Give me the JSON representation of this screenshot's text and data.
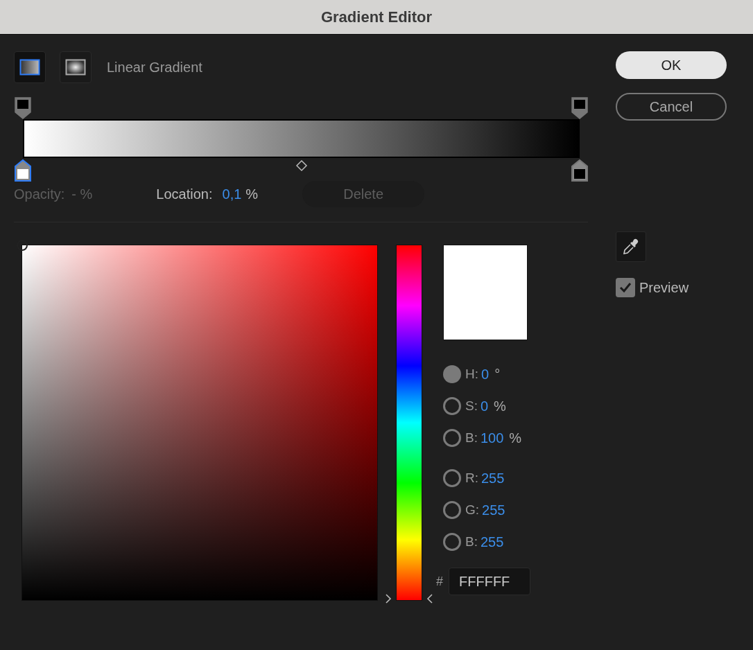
{
  "window": {
    "title": "Gradient Editor"
  },
  "gradient_types": [
    {
      "kind": "linear",
      "selected": true
    },
    {
      "kind": "radial",
      "selected": false
    }
  ],
  "gradient_type_label": "Linear Gradient",
  "opacity_stops": [
    {
      "color": "#000000",
      "selected": false
    },
    {
      "color": "#000000",
      "selected": false
    }
  ],
  "color_stops": [
    {
      "color": "#ffffff",
      "selected": true
    },
    {
      "color": "#000000",
      "selected": false
    }
  ],
  "stop_fields": {
    "opacity": {
      "label": "Opacity:",
      "value": "- %",
      "disabled": true
    },
    "location": {
      "label": "Location:",
      "value": "0,1",
      "unit": "%",
      "disabled": false
    },
    "delete": {
      "label": "Delete",
      "disabled": true
    }
  },
  "color_values": [
    {
      "label": "H:",
      "value": "0",
      "unit": "°",
      "selected": true
    },
    {
      "label": "S:",
      "value": "0",
      "unit": "%",
      "selected": false
    },
    {
      "label": "B:",
      "value": "100",
      "unit": "%",
      "selected": false
    },
    {
      "label": "R:",
      "value": "255",
      "selected": false
    },
    {
      "label": "G:",
      "value": "255",
      "selected": false
    },
    {
      "label": "B:",
      "value": "255",
      "selected": false
    }
  ],
  "hex": {
    "label": "#",
    "value": "FFFFFF"
  },
  "hue_slider": {
    "level": 0
  },
  "buttons": [
    {
      "label": "OK",
      "kind": "primary"
    },
    {
      "label": "Cancel",
      "kind": "secondary"
    }
  ],
  "preview": {
    "label": "Preview",
    "checked": true
  }
}
